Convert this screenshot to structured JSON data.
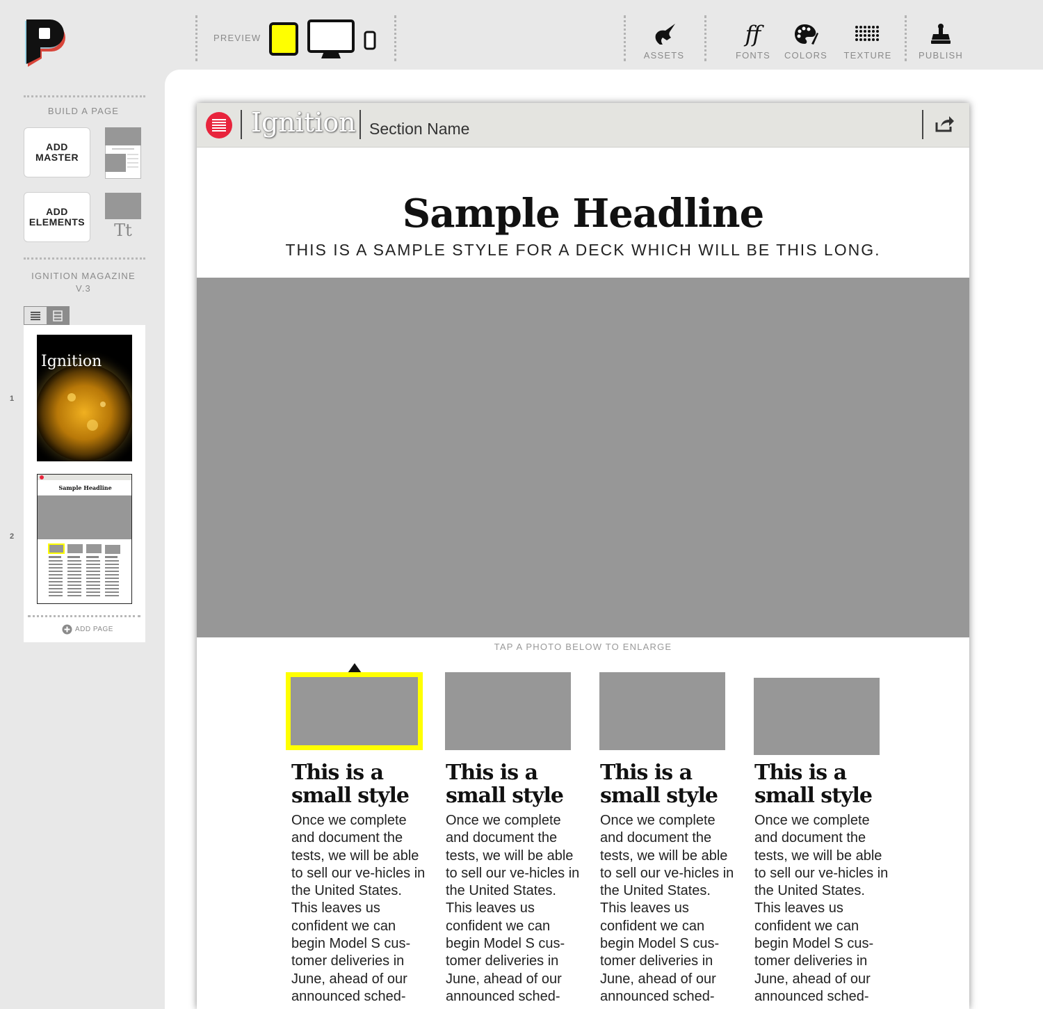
{
  "toolbar": {
    "preview_label": "PREVIEW",
    "tools": [
      {
        "label": "ASSETS",
        "icon": "unicorn-icon"
      },
      {
        "label": "FONTS",
        "icon": "ff-fonts-icon"
      },
      {
        "label": "COLORS",
        "icon": "palette-icon"
      },
      {
        "label": "TEXTURE",
        "icon": "dot-grid-icon"
      },
      {
        "label": "PUBLISH",
        "icon": "stamp-icon"
      }
    ],
    "fonts_glyph": "ff",
    "active_preview": "tablet",
    "accent_color": "#ffff00"
  },
  "sidebar": {
    "build_title": "BUILD A PAGE",
    "add_master": "ADD\nMASTER",
    "add_elements": "ADD\nELEMENTS",
    "elements_glyph": "Tt",
    "magazine_title": "IGNITION MAGAZINE\nV.3",
    "pages": [
      {
        "number": "1",
        "cover_title": "Ignition"
      },
      {
        "number": "2",
        "mini_headline": "Sample Headline"
      }
    ],
    "add_page": "ADD PAGE"
  },
  "page": {
    "brand_color": "#e8243c",
    "magazine_name": "Ignition",
    "section_name": "Section Name",
    "headline": "Sample Headline",
    "deck": "THIS IS A SAMPLE STYLE FOR A DECK WHICH WILL BE THIS LONG.",
    "tap_hint": "TAP A PHOTO BELOW TO ENLARGE",
    "columns": [
      {
        "title": "This is a small style",
        "body": "Once we complete and document the tests, we will be able to sell our ve-hicles in the United States. This leaves us confident we can begin Model S cus-tomer deliveries in June, ahead of our announced sched-",
        "selected": true
      },
      {
        "title": "This is a small style",
        "body": "Once we complete and document the tests, we will be able to sell our ve-hicles in the United States. This leaves us confident we can begin Model S cus-tomer deliveries in June, ahead of our announced sched-",
        "selected": false
      },
      {
        "title": "This is a small style",
        "body": "Once we complete and document the tests, we will be able to sell our ve-hicles in the United States. This leaves us confident we can begin Model S cus-tomer deliveries in June, ahead of our announced sched-",
        "selected": false
      },
      {
        "title": "This is a small style",
        "body": "Once we complete and document the tests, we will be able to sell our ve-hicles in the United States. This leaves us confident we can begin Model S cus-tomer deliveries in June, ahead of our announced sched-",
        "selected": false
      }
    ]
  }
}
